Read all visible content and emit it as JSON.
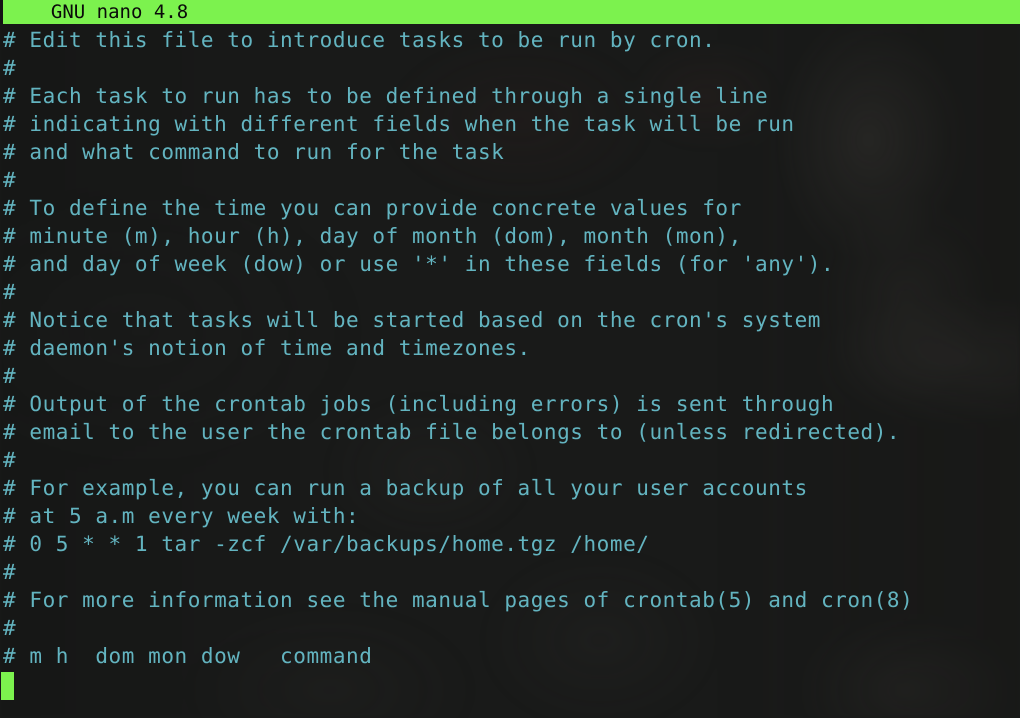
{
  "titlebar": {
    "app_title": "  GNU nano 4.8"
  },
  "editor": {
    "lines": [
      "# Edit this file to introduce tasks to be run by cron.",
      "#",
      "# Each task to run has to be defined through a single line",
      "# indicating with different fields when the task will be run",
      "# and what command to run for the task",
      "#",
      "# To define the time you can provide concrete values for",
      "# minute (m), hour (h), day of month (dom), month (mon),",
      "# and day of week (dow) or use '*' in these fields (for 'any').",
      "#",
      "# Notice that tasks will be started based on the cron's system",
      "# daemon's notion of time and timezones.",
      "#",
      "# Output of the crontab jobs (including errors) is sent through",
      "# email to the user the crontab file belongs to (unless redirected).",
      "#",
      "# For example, you can run a backup of all your user accounts",
      "# at 5 a.m every week with:",
      "# 0 5 * * 1 tar -zcf /var/backups/home.tgz /home/",
      "#",
      "# For more information see the manual pages of crontab(5) and cron(8)",
      "#",
      "# m h  dom mon dow   command",
      ""
    ]
  },
  "cursor": {
    "row": 23,
    "column": 1
  },
  "colors": {
    "titlebar_background": "#7cf24e",
    "titlebar_text": "#0a0a0a",
    "editor_background": "#191a19",
    "comment_text": "#63b4c0",
    "cursor": "#7cf24e"
  }
}
